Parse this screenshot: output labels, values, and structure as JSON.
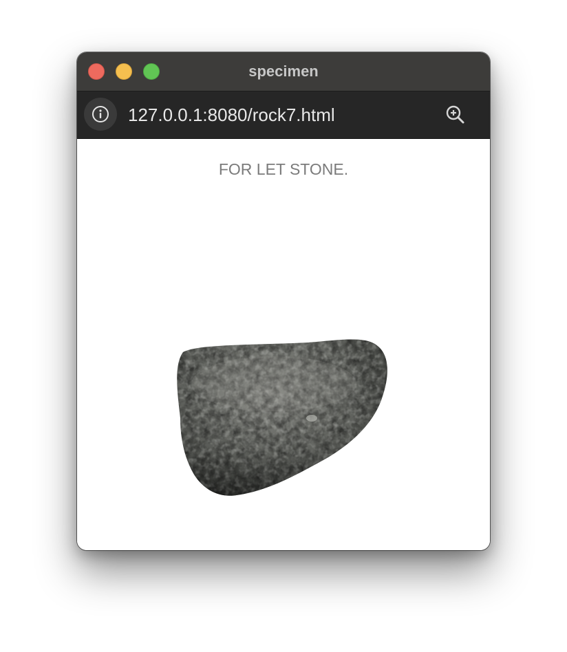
{
  "window": {
    "title": "specimen"
  },
  "toolbar": {
    "url": "127.0.0.1:8080/rock7.html",
    "info_icon": "info-icon",
    "zoom_icon": "zoom-in-icon"
  },
  "page": {
    "heading": "FOR LET STONE.",
    "image": "rock-3d-model"
  },
  "colors": {
    "close": "#ed6a5e",
    "minimize": "#f5bf4f",
    "zoom": "#61c554",
    "titlebar": "#3d3c3a",
    "toolbar": "#262626"
  }
}
